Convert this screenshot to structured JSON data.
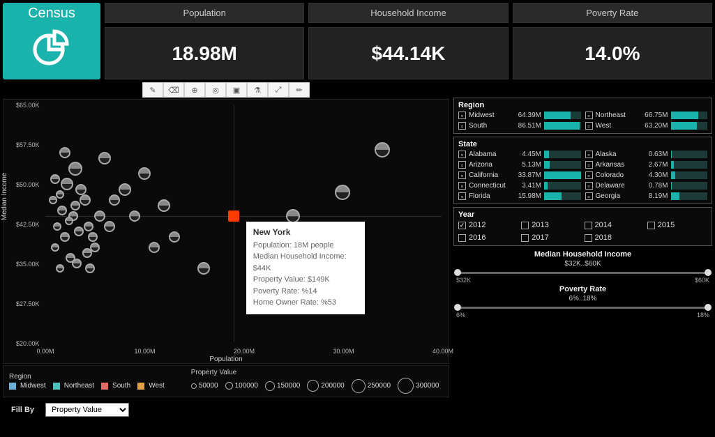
{
  "header": {
    "brand": "Census",
    "kpis": [
      {
        "label": "Population",
        "value": "18.98M"
      },
      {
        "label": "Household Income",
        "value": "$44.14K"
      },
      {
        "label": "Poverty Rate",
        "value": "14.0%"
      }
    ]
  },
  "toolbar_icons": [
    "brush",
    "eraser",
    "zoom",
    "hide",
    "fit",
    "microscope",
    "expand",
    "pencil"
  ],
  "chart_data": {
    "type": "scatter",
    "xlabel": "Population",
    "ylabel": "Median Income",
    "xlim": [
      0,
      40
    ],
    "ylim": [
      20,
      65
    ],
    "x_ticks": [
      "0.00M",
      "10.00M",
      "20.00M",
      "30.00M",
      "40.00M"
    ],
    "y_ticks": [
      "$20.00K",
      "$27.50K",
      "$35.00K",
      "$42.50K",
      "$50.00K",
      "$57.50K",
      "$65.00K"
    ],
    "size_legend_label": "Property Value",
    "size_legend": [
      50000,
      100000,
      150000,
      200000,
      250000,
      300000
    ],
    "region_legend": [
      {
        "name": "Midwest",
        "color": "#6ab0d8"
      },
      {
        "name": "Northeast",
        "color": "#4fc2bd"
      },
      {
        "name": "South",
        "color": "#e46a6a"
      },
      {
        "name": "West",
        "color": "#e0a245"
      }
    ],
    "selected_point": {
      "x": 19,
      "y": 44,
      "label": "New York"
    },
    "points": [
      {
        "x": 1,
        "y": 51,
        "s": 14
      },
      {
        "x": 1.5,
        "y": 48,
        "s": 12
      },
      {
        "x": 2,
        "y": 56,
        "s": 16
      },
      {
        "x": 2.2,
        "y": 50,
        "s": 18
      },
      {
        "x": 3,
        "y": 46,
        "s": 14
      },
      {
        "x": 3,
        "y": 53,
        "s": 20
      },
      {
        "x": 1.2,
        "y": 42,
        "s": 12
      },
      {
        "x": 2,
        "y": 40,
        "s": 14
      },
      {
        "x": 2.8,
        "y": 44,
        "s": 14
      },
      {
        "x": 4,
        "y": 47,
        "s": 16
      },
      {
        "x": 4.4,
        "y": 42,
        "s": 14
      },
      {
        "x": 5,
        "y": 38,
        "s": 14
      },
      {
        "x": 2.5,
        "y": 36,
        "s": 14
      },
      {
        "x": 1.5,
        "y": 34,
        "s": 12
      },
      {
        "x": 3.2,
        "y": 35,
        "s": 14
      },
      {
        "x": 4.5,
        "y": 34,
        "s": 14
      },
      {
        "x": 1,
        "y": 38,
        "s": 12
      },
      {
        "x": 6,
        "y": 55,
        "s": 18
      },
      {
        "x": 7,
        "y": 47,
        "s": 16
      },
      {
        "x": 8,
        "y": 49,
        "s": 18
      },
      {
        "x": 9,
        "y": 44,
        "s": 16
      },
      {
        "x": 10,
        "y": 52,
        "s": 18
      },
      {
        "x": 11,
        "y": 38,
        "s": 16
      },
      {
        "x": 12,
        "y": 46,
        "s": 18
      },
      {
        "x": 13,
        "y": 40,
        "s": 16
      },
      {
        "x": 16,
        "y": 34,
        "s": 18
      },
      {
        "x": 3.4,
        "y": 41,
        "s": 14
      },
      {
        "x": 4.2,
        "y": 37,
        "s": 14
      },
      {
        "x": 1.7,
        "y": 45,
        "s": 14
      },
      {
        "x": 2.4,
        "y": 43,
        "s": 12
      },
      {
        "x": 5.5,
        "y": 44,
        "s": 16
      },
      {
        "x": 0.8,
        "y": 47,
        "s": 12
      },
      {
        "x": 6.5,
        "y": 42,
        "s": 16
      },
      {
        "x": 4.8,
        "y": 40,
        "s": 14
      },
      {
        "x": 3.6,
        "y": 49,
        "s": 16
      },
      {
        "x": 25,
        "y": 44,
        "s": 20
      },
      {
        "x": 30,
        "y": 48.5,
        "s": 22
      },
      {
        "x": 34,
        "y": 56.5,
        "s": 22
      }
    ]
  },
  "tooltip": {
    "title": "New York",
    "rows": [
      "Population:  18M people",
      "Median Household Income:  $44K",
      "Property Value:  $149K",
      "Poverty Rate:  %14",
      "Home Owner Rate: %53"
    ]
  },
  "fillby": {
    "label": "Fill By",
    "selected": "Property Value",
    "options": [
      "Property Value"
    ]
  },
  "region_panel": {
    "title": "Region",
    "items": [
      {
        "name": "Midwest",
        "value": "64.39M",
        "pct": 72
      },
      {
        "name": "Northeast",
        "value": "66.75M",
        "pct": 75
      },
      {
        "name": "South",
        "value": "86.51M",
        "pct": 97
      },
      {
        "name": "West",
        "value": "63.20M",
        "pct": 71
      }
    ]
  },
  "state_panel": {
    "title": "State",
    "items": [
      {
        "name": "Alabama",
        "value": "4.45M",
        "pct": 13
      },
      {
        "name": "Alaska",
        "value": "0.63M",
        "pct": 2
      },
      {
        "name": "Arizona",
        "value": "5.13M",
        "pct": 15
      },
      {
        "name": "Arkansas",
        "value": "2.67M",
        "pct": 8
      },
      {
        "name": "California",
        "value": "33.87M",
        "pct": 100
      },
      {
        "name": "Colorado",
        "value": "4.30M",
        "pct": 13
      },
      {
        "name": "Connecticut",
        "value": "3.41M",
        "pct": 10
      },
      {
        "name": "Delaware",
        "value": "0.78M",
        "pct": 2
      },
      {
        "name": "Florida",
        "value": "15.98M",
        "pct": 47
      },
      {
        "name": "Georgia",
        "value": "8.19M",
        "pct": 24
      }
    ]
  },
  "year_panel": {
    "title": "Year",
    "items": [
      "2012",
      "2013",
      "2014",
      "2015",
      "2016",
      "2017",
      "2018"
    ],
    "selected": "2012"
  },
  "sliders": [
    {
      "title": "Median Household Income",
      "range": "$32K..$60K",
      "lo": "$32K",
      "hi": "$60K"
    },
    {
      "title": "Poverty Rate",
      "range": "6%..18%",
      "lo": "6%",
      "hi": "18%"
    }
  ],
  "legend_region_label": "Region"
}
